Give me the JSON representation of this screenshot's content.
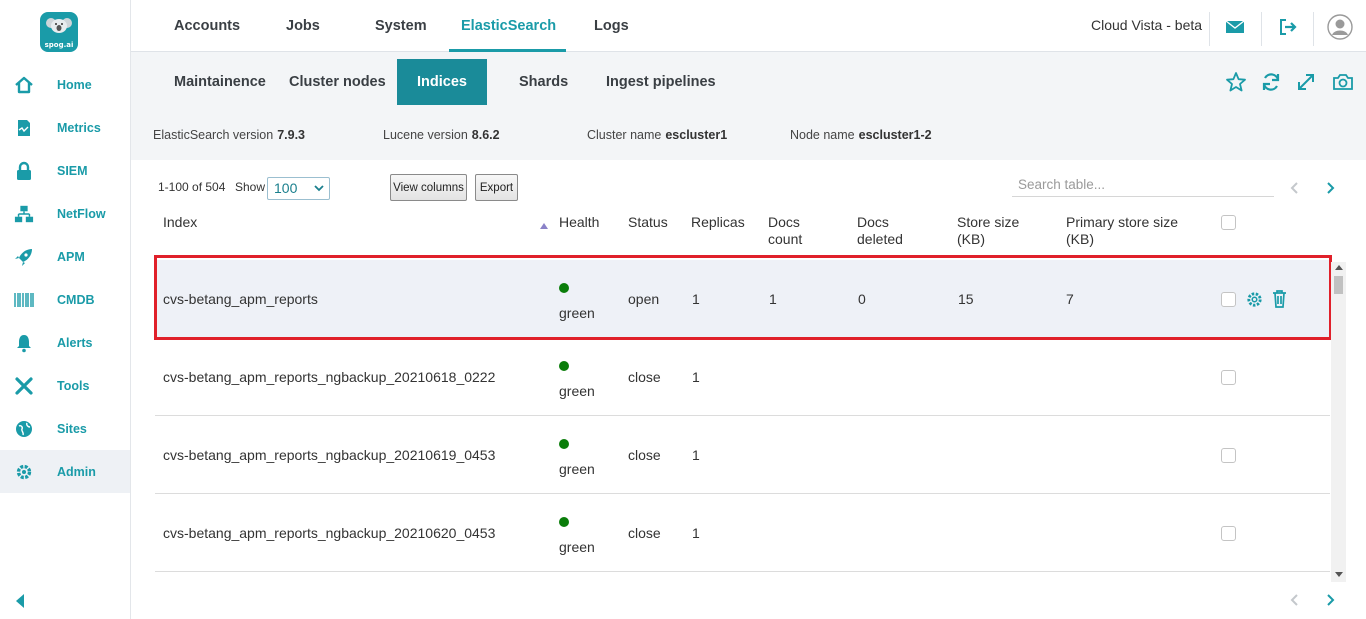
{
  "app": {
    "brand": "spog.ai",
    "title": "Cloud Vista - beta"
  },
  "colors": {
    "accent": "#1a9ba8",
    "health_green": "#0a7d0a",
    "highlight": "#e0202a"
  },
  "sidebar": {
    "items": [
      {
        "label": "Home",
        "icon": "home-icon"
      },
      {
        "label": "Metrics",
        "icon": "metrics-icon"
      },
      {
        "label": "SIEM",
        "icon": "lock-icon"
      },
      {
        "label": "NetFlow",
        "icon": "netflow-icon"
      },
      {
        "label": "APM",
        "icon": "rocket-icon"
      },
      {
        "label": "CMDB",
        "icon": "barcode-icon"
      },
      {
        "label": "Alerts",
        "icon": "bell-icon"
      },
      {
        "label": "Tools",
        "icon": "tools-icon"
      },
      {
        "label": "Sites",
        "icon": "globe-icon"
      },
      {
        "label": "Admin",
        "icon": "gear-icon"
      }
    ],
    "active": "Admin"
  },
  "top_tabs": [
    "Accounts",
    "Jobs",
    "System",
    "ElasticSearch",
    "Logs"
  ],
  "top_tabs_active": "ElasticSearch",
  "sub_tabs": [
    "Maintainence",
    "Cluster nodes",
    "Indices",
    "Shards",
    "Ingest pipelines"
  ],
  "sub_tabs_active": "Indices",
  "info": {
    "es_version_label": "ElasticSearch version",
    "es_version": "7.9.3",
    "lucene_label": "Lucene version",
    "lucene": "8.6.2",
    "cluster_label": "Cluster name",
    "cluster": "escluster1",
    "node_label": "Node name",
    "node": "escluster1-2"
  },
  "table_controls": {
    "range": "1-100 of 504",
    "show_label": "Show",
    "page_size": "100",
    "view_columns": "View columns",
    "export": "Export",
    "search_placeholder": "Search table..."
  },
  "columns": {
    "index": "Index",
    "health": "Health",
    "status": "Status",
    "replicas": "Replicas",
    "docs_count_1": "Docs",
    "docs_count_2": "count",
    "docs_deleted_1": "Docs",
    "docs_deleted_2": "deleted",
    "store_size_1": "Store size",
    "store_size_2": "(KB)",
    "primary_size_1": "Primary store size",
    "primary_size_2": "(KB)"
  },
  "rows": [
    {
      "index": "cvs-betang_apm_reports",
      "health": "green",
      "status": "open",
      "replicas": "1",
      "docs_count": "1",
      "docs_deleted": "0",
      "store_size": "15",
      "primary_store_size": "7"
    },
    {
      "index": "cvs-betang_apm_reports_ngbackup_20210618_0222",
      "health": "green",
      "status": "close",
      "replicas": "1",
      "docs_count": "",
      "docs_deleted": "",
      "store_size": "",
      "primary_store_size": ""
    },
    {
      "index": "cvs-betang_apm_reports_ngbackup_20210619_0453",
      "health": "green",
      "status": "close",
      "replicas": "1",
      "docs_count": "",
      "docs_deleted": "",
      "store_size": "",
      "primary_store_size": ""
    },
    {
      "index": "cvs-betang_apm_reports_ngbackup_20210620_0453",
      "health": "green",
      "status": "close",
      "replicas": "1",
      "docs_count": "",
      "docs_deleted": "",
      "store_size": "",
      "primary_store_size": ""
    }
  ]
}
